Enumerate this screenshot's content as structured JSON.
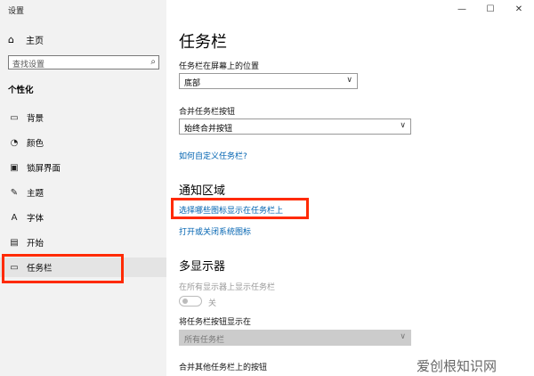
{
  "window": {
    "title": "设置",
    "minimize": "—",
    "maximize": "☐",
    "close": "✕"
  },
  "sidebar": {
    "home": "主页",
    "search_placeholder": "查找设置",
    "section": "个性化",
    "items": [
      {
        "label": "背景",
        "icon": "image-icon",
        "glyph": "▭"
      },
      {
        "label": "颜色",
        "icon": "palette-icon",
        "glyph": "◔"
      },
      {
        "label": "锁屏界面",
        "icon": "lock-screen-icon",
        "glyph": "▣"
      },
      {
        "label": "主题",
        "icon": "theme-icon",
        "glyph": "✎"
      },
      {
        "label": "字体",
        "icon": "font-icon",
        "glyph": "A"
      },
      {
        "label": "开始",
        "icon": "start-icon",
        "glyph": "▤"
      },
      {
        "label": "任务栏",
        "icon": "taskbar-icon",
        "glyph": "▭"
      }
    ]
  },
  "main": {
    "title": "任务栏",
    "position_label": "任务栏在屏幕上的位置",
    "position_value": "底部",
    "combine_label": "合并任务栏按钮",
    "combine_value": "始终合并按钮",
    "customize_link": "如何自定义任务栏?",
    "notification_head": "通知区域",
    "select_icons_link": "选择哪些图标显示在任务栏上",
    "system_icons_link": "打开或关闭系统图标",
    "multi_head": "多显示器",
    "show_all_label": "在所有显示器上显示任务栏",
    "toggle_state": "关",
    "show_buttons_label": "将任务栏按钮显示在",
    "show_buttons_value": "所有任务栏",
    "combine_other_label": "合并其他任务栏上的按钮"
  },
  "watermark": "爱创根知识网"
}
